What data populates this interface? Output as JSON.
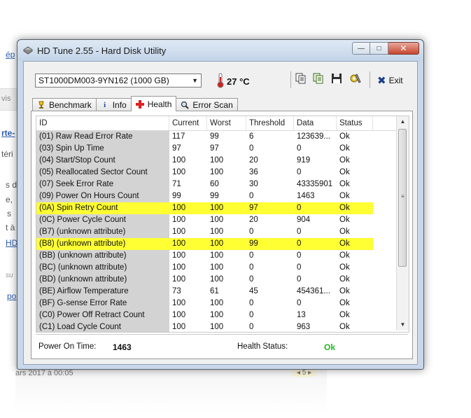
{
  "background": {
    "fragments": [
      "ép",
      "vis",
      "rte-",
      "téri",
      "s d",
      "e,",
      "s",
      "t à",
      "HD",
      "su",
      "po"
    ],
    "footer_date": "ars 2017 à 00:05",
    "pager": "◂ 5 ▸"
  },
  "window": {
    "title": "HD Tune 2.55 - Hard Disk Utility",
    "controls": {
      "minimize": "—",
      "maximize": "□",
      "close": "✕"
    }
  },
  "toolbar": {
    "drive": "ST1000DM003-9YN162 (1000 GB)",
    "temperature": "27 °C",
    "exit_label": "Exit"
  },
  "tabs": [
    {
      "label": "Benchmark",
      "icon": "benchmark-icon",
      "active": false
    },
    {
      "label": "Info",
      "icon": "info-icon",
      "active": false
    },
    {
      "label": "Health",
      "icon": "health-cross-icon",
      "active": true
    },
    {
      "label": "Error Scan",
      "icon": "magnifier-icon",
      "active": false
    }
  ],
  "table": {
    "columns": [
      "ID",
      "Current",
      "Worst",
      "Threshold",
      "Data",
      "Status"
    ],
    "rows": [
      {
        "id": "(01) Raw Read Error Rate",
        "current": "117",
        "worst": "99",
        "threshold": "6",
        "data": "123639...",
        "status": "Ok",
        "highlight": false
      },
      {
        "id": "(03) Spin Up Time",
        "current": "97",
        "worst": "97",
        "threshold": "0",
        "data": "0",
        "status": "Ok",
        "highlight": false
      },
      {
        "id": "(04) Start/Stop Count",
        "current": "100",
        "worst": "100",
        "threshold": "20",
        "data": "919",
        "status": "Ok",
        "highlight": false
      },
      {
        "id": "(05) Reallocated Sector Count",
        "current": "100",
        "worst": "100",
        "threshold": "36",
        "data": "0",
        "status": "Ok",
        "highlight": false
      },
      {
        "id": "(07) Seek Error Rate",
        "current": "71",
        "worst": "60",
        "threshold": "30",
        "data": "43335901",
        "status": "Ok",
        "highlight": false
      },
      {
        "id": "(09) Power On Hours Count",
        "current": "99",
        "worst": "99",
        "threshold": "0",
        "data": "1463",
        "status": "Ok",
        "highlight": false
      },
      {
        "id": "(0A) Spin Retry Count",
        "current": "100",
        "worst": "100",
        "threshold": "97",
        "data": "0",
        "status": "Ok",
        "highlight": true
      },
      {
        "id": "(0C) Power Cycle Count",
        "current": "100",
        "worst": "100",
        "threshold": "20",
        "data": "904",
        "status": "Ok",
        "highlight": false
      },
      {
        "id": "(B7) (unknown attribute)",
        "current": "100",
        "worst": "100",
        "threshold": "0",
        "data": "0",
        "status": "Ok",
        "highlight": false
      },
      {
        "id": "(B8) (unknown attribute)",
        "current": "100",
        "worst": "100",
        "threshold": "99",
        "data": "0",
        "status": "Ok",
        "highlight": true
      },
      {
        "id": "(BB) (unknown attribute)",
        "current": "100",
        "worst": "100",
        "threshold": "0",
        "data": "0",
        "status": "Ok",
        "highlight": false
      },
      {
        "id": "(BC) (unknown attribute)",
        "current": "100",
        "worst": "100",
        "threshold": "0",
        "data": "0",
        "status": "Ok",
        "highlight": false
      },
      {
        "id": "(BD) (unknown attribute)",
        "current": "100",
        "worst": "100",
        "threshold": "0",
        "data": "0",
        "status": "Ok",
        "highlight": false
      },
      {
        "id": "(BE) Airflow Temperature",
        "current": "73",
        "worst": "61",
        "threshold": "45",
        "data": "454361...",
        "status": "Ok",
        "highlight": false
      },
      {
        "id": "(BF) G-sense Error Rate",
        "current": "100",
        "worst": "100",
        "threshold": "0",
        "data": "0",
        "status": "Ok",
        "highlight": false
      },
      {
        "id": "(C0) Power Off Retract Count",
        "current": "100",
        "worst": "100",
        "threshold": "0",
        "data": "13",
        "status": "Ok",
        "highlight": false
      },
      {
        "id": "(C1) Load Cycle Count",
        "current": "100",
        "worst": "100",
        "threshold": "0",
        "data": "963",
        "status": "Ok",
        "highlight": false
      }
    ]
  },
  "status": {
    "power_on_label": "Power On Time:",
    "power_on_value": "1463",
    "health_label": "Health Status:",
    "health_value": "Ok"
  },
  "colors": {
    "highlight": "#ffff33",
    "ok_green": "#1fbb1f",
    "exit_blue": "#1c3e8a"
  }
}
